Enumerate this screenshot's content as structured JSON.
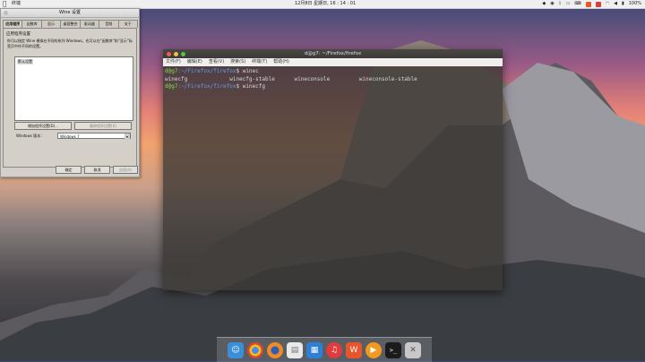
{
  "topbar": {
    "app_name": "终端",
    "clock": "12月8日 星期日, 16 : 14 : 01",
    "battery": "100%"
  },
  "wine": {
    "title": "Wine 设置",
    "tabs": [
      "应用程序",
      "函数库",
      "显示",
      "桌面整合",
      "驱动器",
      "音频",
      "关于"
    ],
    "section": "应用程序设置",
    "description": "你可以指定 Wine 模拟在不同的系列 Windows。也可以在“函数库”和“显示”标签页中作不同的设置。",
    "list_item": "默认设置",
    "add_button": "增加程序设置(D)...",
    "remove_button": "删除程序设置(R)",
    "version_label": "Windows 版本：",
    "version_value": "Windows 7",
    "ok": "确定",
    "cancel": "取消",
    "apply": "应用(A)"
  },
  "terminal": {
    "title": "d@g7: ~/Firefox/firefox",
    "menu": [
      "文件(F)",
      "编辑(E)",
      "查看(V)",
      "搜索(S)",
      "终端(T)",
      "帮助(H)"
    ],
    "prompt_user": "d@g7",
    "prompt_path": ":~/Firefox/firefox",
    "cmd1": "$ winec",
    "completions": "winecfg             winecfg-stable      wineconsole         wineconsole-stable",
    "cmd2": "$ winecfg"
  },
  "dock": {
    "items": [
      "finder-icon",
      "chrome-icon",
      "firefox-icon",
      "files-icon",
      "store-icon",
      "music-icon",
      "wps-icon",
      "player-icon",
      "terminal-icon",
      "trash-icon"
    ]
  }
}
